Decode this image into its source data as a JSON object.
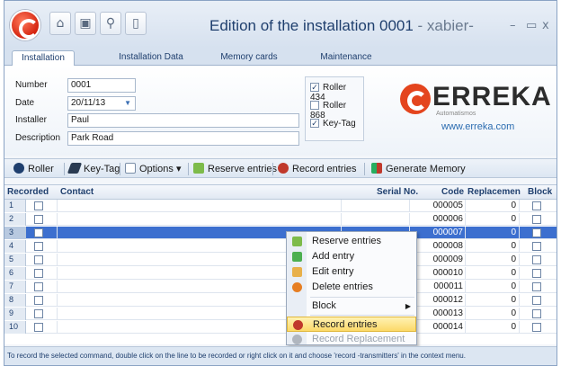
{
  "window": {
    "title": "Edition of the installation 0001",
    "title_user": " - xabier-",
    "minimize": "–",
    "maximize": "▭",
    "close": "x"
  },
  "tabs": [
    "Installation",
    "Installation Data",
    "Memory cards",
    "Maintenance"
  ],
  "form": {
    "number_label": "Number",
    "number_value": "0001",
    "date_label": "Date",
    "date_value": "20/11/13",
    "installer_label": "Installer",
    "installer_value": "Paul",
    "description_label": "Description",
    "description_value": "Park Road",
    "options": [
      {
        "label": "Roller 434",
        "checked": true
      },
      {
        "label": "Roller 868",
        "checked": false
      },
      {
        "label": "Key-Tag",
        "checked": true
      }
    ]
  },
  "brand": {
    "name": "ERREKA",
    "sub": "Automatismos",
    "url": "www.erreka.com",
    "color": "#e4451e"
  },
  "toolbar": {
    "roller": "Roller",
    "keytag": "Key-Tag",
    "options": "Options",
    "reserve": "Reserve entries",
    "record": "Record entries",
    "generate": "Generate Memory"
  },
  "grid": {
    "headers": {
      "recorded": "Recorded",
      "contact": "Contact",
      "serial": "Serial No.",
      "code": "Code",
      "replacement": "Replacemen",
      "block": "Block"
    },
    "rows": [
      {
        "n": "1",
        "code": "000005",
        "repl": "0"
      },
      {
        "n": "2",
        "code": "000006",
        "repl": "0"
      },
      {
        "n": "3",
        "code": "000007",
        "repl": "0"
      },
      {
        "n": "4",
        "code": "000008",
        "repl": "0"
      },
      {
        "n": "5",
        "code": "000009",
        "repl": "0"
      },
      {
        "n": "6",
        "code": "000010",
        "repl": "0"
      },
      {
        "n": "7",
        "code": "000011",
        "repl": "0"
      },
      {
        "n": "8",
        "code": "000012",
        "repl": "0"
      },
      {
        "n": "9",
        "code": "000013",
        "repl": "0"
      },
      {
        "n": "10",
        "code": "000014",
        "repl": "0"
      }
    ],
    "selected_row": 3
  },
  "context_menu": {
    "items": [
      {
        "label": "Reserve entries",
        "icon": "reserve-icon"
      },
      {
        "label": "Add entry",
        "icon": "add-icon"
      },
      {
        "label": "Edit entry",
        "icon": "edit-icon"
      },
      {
        "label": "Delete entries",
        "icon": "delete-icon"
      },
      {
        "label": "Block",
        "icon": "submenu-arrow-icon"
      },
      {
        "label": "Record entries",
        "icon": "record-icon"
      },
      {
        "label": "Record Replacement",
        "icon": "record-replacement-icon",
        "disabled": true
      }
    ]
  },
  "status": {
    "text": "To record the selected command, double click on the line to be recorded or right click on it and choose 'record -transmitters' in the context menu."
  }
}
